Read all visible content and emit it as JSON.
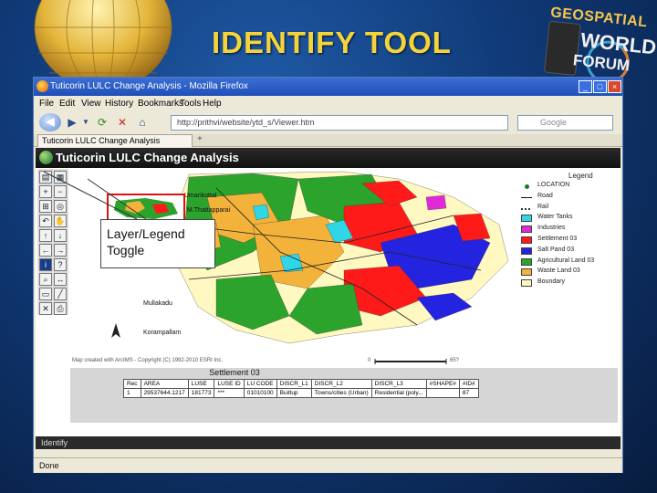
{
  "slide": {
    "title": "IDENTIFY TOOL",
    "logo": {
      "line1": "GEOSPATIAL",
      "line2": "WORLD",
      "line3": "FORUM"
    },
    "accent_color": "#f5d43a"
  },
  "browser": {
    "window_title": "Tuticorin LULC Change Analysis - Mozilla Firefox",
    "window_buttons": [
      "_",
      "□",
      "×"
    ],
    "menu": [
      "File",
      "Edit",
      "View",
      "History",
      "Bookmarks",
      "Tools",
      "Help"
    ],
    "nav_icons": [
      "back-icon",
      "forward-icon",
      "dropdown-icon",
      "reload-icon",
      "stop-icon",
      "home-icon"
    ],
    "url": "http://prithvi/website/ytd_s/Viewer.htm",
    "search_placeholder": "Google",
    "tab_label": "Tuticorin LULC Change Analysis",
    "tab_plus": "+",
    "status": "Done"
  },
  "app": {
    "header_title": "Tuticorin LULC Change Analysis",
    "map_labels": [
      "Umarikottal",
      "M.Thattapparai",
      "Mullakadu",
      "Korampallam"
    ],
    "map_credit": "Map created with ArcIMS - Copyright (C) 1992-2010 ESRI Inc.",
    "scale_start": "0",
    "scale_end": "65?",
    "legend_title": "Legend",
    "legend": [
      {
        "label": "LOCATION",
        "color": "#1a7a1a",
        "kind": "dot"
      },
      {
        "label": "Road",
        "color": "#111111",
        "kind": "line"
      },
      {
        "label": "Rail",
        "color": "#333333",
        "kind": "rail"
      },
      {
        "label": "Water Tanks",
        "color": "#2fd6e6",
        "kind": "box"
      },
      {
        "label": "Industries",
        "color": "#e02ad8",
        "kind": "box"
      },
      {
        "label": "Settlement 03",
        "color": "#ff1a1a",
        "kind": "box"
      },
      {
        "label": "Salt Pand 03",
        "color": "#2424e0",
        "kind": "box"
      },
      {
        "label": "Agricultural Land 03",
        "color": "#2ca32c",
        "kind": "box"
      },
      {
        "label": "Waste Land 03",
        "color": "#f3b23a",
        "kind": "box"
      },
      {
        "label": "Boundary",
        "color": "#fff8c0",
        "kind": "box"
      }
    ],
    "results_title": "Settlement 03",
    "results_headers": [
      "Rec",
      "AREA",
      "LUSE",
      "LUSE ID",
      "LU CODE",
      "DISCR_L1",
      "DISCR_L2",
      "DISCR_L3",
      "#SHAPE#",
      "#ID#"
    ],
    "results_row": [
      "1",
      "29537644.1217",
      "181773",
      "***",
      "01010100",
      "Builtup",
      "Towns/cities (Urban)",
      "Residential (poly...",
      "",
      "87"
    ],
    "identify_label": "Identify",
    "callout": {
      "line1": "Layer/Legend",
      "line2": "Toggle"
    },
    "toolbar_icons": [
      "layer-toggle-icon",
      "legend-icon",
      "zoom-in-icon",
      "zoom-out-icon",
      "full-extent-icon",
      "zoom-active-icon",
      "back-extent-icon",
      "pan-icon",
      "pan-north-icon",
      "pan-south-icon",
      "pan-west-icon",
      "pan-east-icon",
      "identify-icon",
      "query-icon",
      "find-icon",
      "measure-icon",
      "select-rect-icon",
      "select-line-icon",
      "clear-icon",
      "print-icon"
    ],
    "landcover_colors": [
      "#2ca32c",
      "#f3b23a",
      "#ff1a1a",
      "#2424e0",
      "#2fd6e6",
      "#e02ad8",
      "#fff8c0"
    ]
  }
}
